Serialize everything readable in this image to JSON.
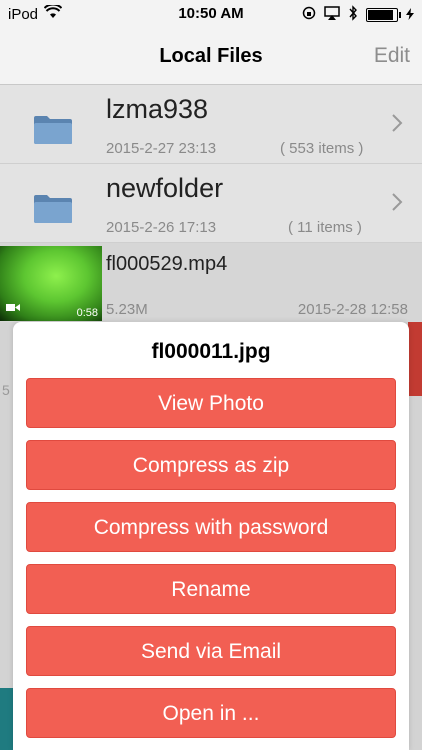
{
  "status_bar": {
    "carrier": "iPod",
    "time": "10:50 AM",
    "wifi_icon": "wifi-icon",
    "battery_level": 0.95
  },
  "navbar": {
    "title": "Local Files",
    "edit_label": "Edit"
  },
  "files": [
    {
      "name": "lzma938",
      "date": "2015-2-27 23:13",
      "count": "( 553 items )",
      "icon": "folder-icon"
    },
    {
      "name": "newfolder",
      "date": "2015-2-26 17:13",
      "count": "( 11 items )",
      "icon": "folder-icon"
    }
  ],
  "video": {
    "name": "fl000529.mp4",
    "size": "5.23M",
    "date": "2015-2-28 12:58",
    "duration": "0:58",
    "icon": "video-camera-icon"
  },
  "background_fragments": {
    "partial_digit": "5"
  },
  "sheet": {
    "title": "fl000011.jpg",
    "buttons": [
      {
        "label": "View Photo"
      },
      {
        "label": "Compress as zip"
      },
      {
        "label": "Compress with password"
      },
      {
        "label": "Rename"
      },
      {
        "label": "Send via Email"
      },
      {
        "label": "Open in ..."
      }
    ]
  },
  "colors": {
    "button": "#f25f53",
    "accent_red": "#c23b32",
    "accent_teal": "#1f7b80"
  }
}
